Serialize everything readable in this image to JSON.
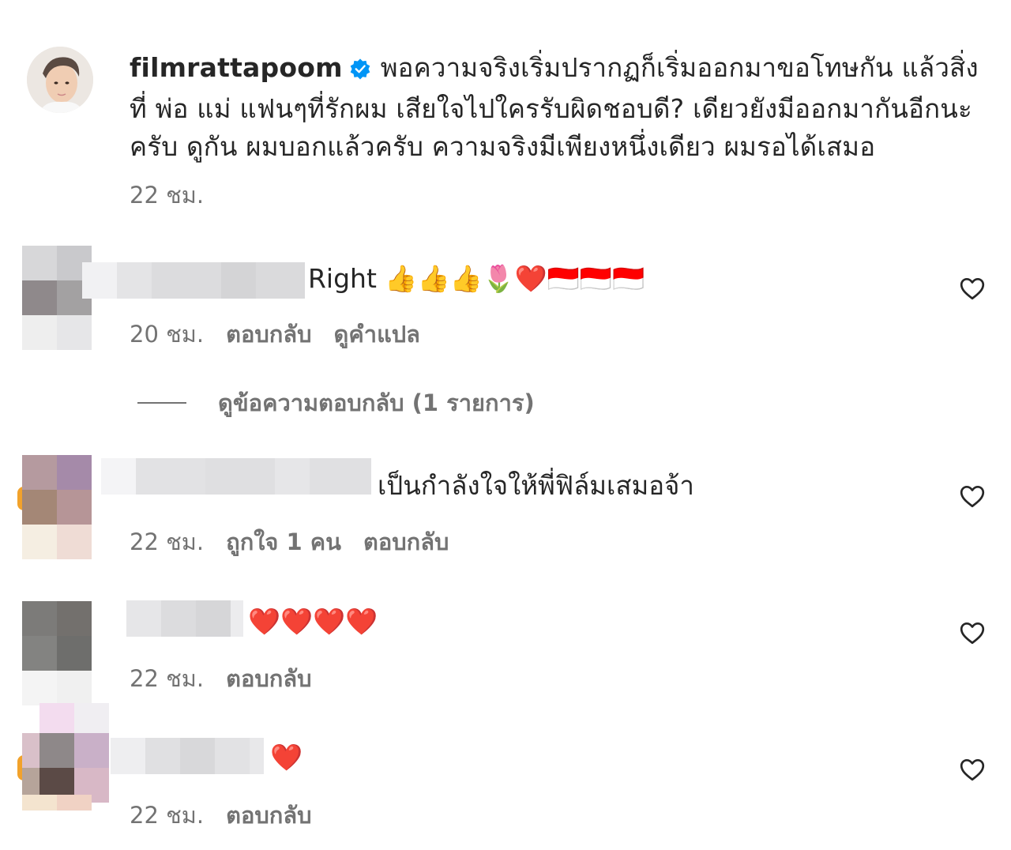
{
  "post": {
    "username": "filmrattapoom",
    "verified": true,
    "caption": "พอความจริงเริ่มปรากฏก็เริ่มออกมาขอโทษกัน แล้วสิ่งที่ พ่อ แม่ แฟนๆที่รักผม เสียใจไปใครรับผิดชอบดี? เดียวยังมีออกมากันอีกนะครับ ดูกัน ผมบอกแล้วครับ ความจริงมีเพียงหนึ่งเดียว ผมรอได้เสมอ",
    "time": "22 ชม."
  },
  "comments": [
    {
      "text": "Right 👍👍👍🌷❤️🇮🇩🇮🇩🇮🇩",
      "time": "20 ชม.",
      "reply_label": "ตอบกลับ",
      "translate_label": "ดูคำแปล"
    },
    {
      "text": "เป็นกำลังใจให้พี่ฟิล์มเสมอจ้า",
      "time": "22 ชม.",
      "likes_label": "ถูกใจ 1 คน",
      "reply_label": "ตอบกลับ"
    },
    {
      "text": "❤️❤️❤️❤️",
      "time": "22 ชม.",
      "reply_label": "ตอบกลับ"
    },
    {
      "text": "❤️",
      "time": "22 ชม.",
      "reply_label": "ตอบกลับ"
    }
  ],
  "view_replies_label": "ดูข้อความตอบกลับ (1 รายการ)",
  "icons": {
    "like": "heart-outline-icon",
    "verified": "verified-badge-icon"
  },
  "colors": {
    "verified_blue": "#0095f6",
    "text": "#262626",
    "secondary": "#737373",
    "heart_red": "#e0202e"
  }
}
